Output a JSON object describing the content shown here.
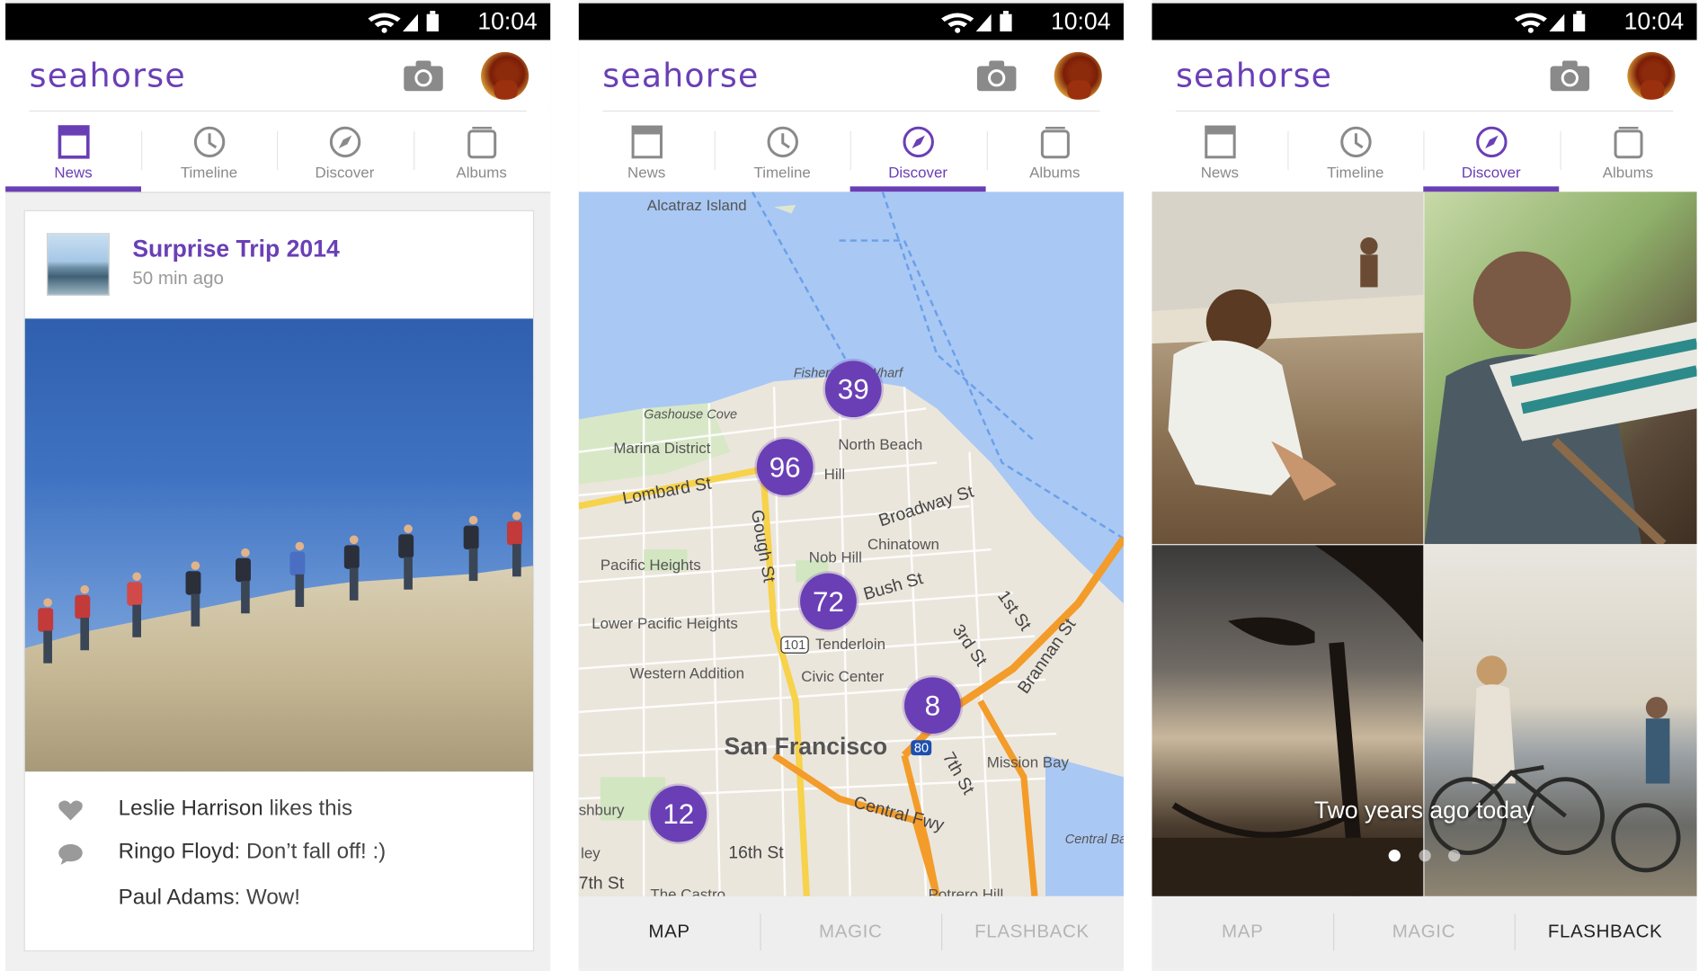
{
  "status_bar": {
    "time": "10:04"
  },
  "app": {
    "title": "seahorse"
  },
  "tabs": [
    "News",
    "Timeline",
    "Discover",
    "Albums"
  ],
  "screens": [
    {
      "active_tab": "News",
      "card": {
        "title": "Surprise Trip 2014",
        "time": "50 min ago",
        "comments": [
          {
            "name": "Leslie Harrison",
            "text": " likes this"
          },
          {
            "name": "Ringo Floyd",
            "text": ": Don’t fall off! :)"
          },
          {
            "name": "Paul Adams",
            "text": ": Wow!"
          }
        ]
      }
    },
    {
      "active_tab": "Discover",
      "map": {
        "labels": [
          "Alcatraz Island",
          "Fisherman's Wharf",
          "Gashouse Cove",
          "Marina District",
          "North Beach",
          "Lombard St",
          "Hill",
          "Broadway St",
          "Gough St",
          "Chinatown",
          "Nob Hill",
          "Pacific Heights",
          "Bush St",
          "1st St",
          "Lower Pacific Heights",
          "Tenderloin",
          "3rd St",
          "Brannan St",
          "Western Addition",
          "Civic Center",
          "San Francisco",
          "Mission Bay",
          "7th St",
          "Central Fwy",
          "Central Ba",
          "shbury",
          "16th St",
          "7th St",
          "The Castro",
          "Potrero Hill",
          "ley",
          "101",
          "80"
        ],
        "clusters": [
          39,
          96,
          72,
          8,
          12
        ]
      },
      "bottom_tabs": [
        "MAP",
        "MAGIC",
        "FLASHBACK"
      ],
      "active_bottom_tab": "MAP"
    },
    {
      "active_tab": "Discover",
      "flashback": {
        "caption": "Two years ago today",
        "pages": 3,
        "active_page": 1
      },
      "bottom_tabs": [
        "MAP",
        "MAGIC",
        "FLASHBACK"
      ],
      "active_bottom_tab": "FLASHBACK"
    }
  ],
  "colors": {
    "accent": "#6a3fb5",
    "statusbar": "#000000",
    "cluster": "#6a3fb5"
  },
  "icons": {
    "tabs": [
      "news-icon",
      "timeline-clock-icon",
      "discover-compass-icon",
      "albums-icon"
    ],
    "appbar": [
      "camera-icon",
      "avatar"
    ],
    "comments": [
      "heart-icon",
      "comment-bubble-icon"
    ]
  }
}
